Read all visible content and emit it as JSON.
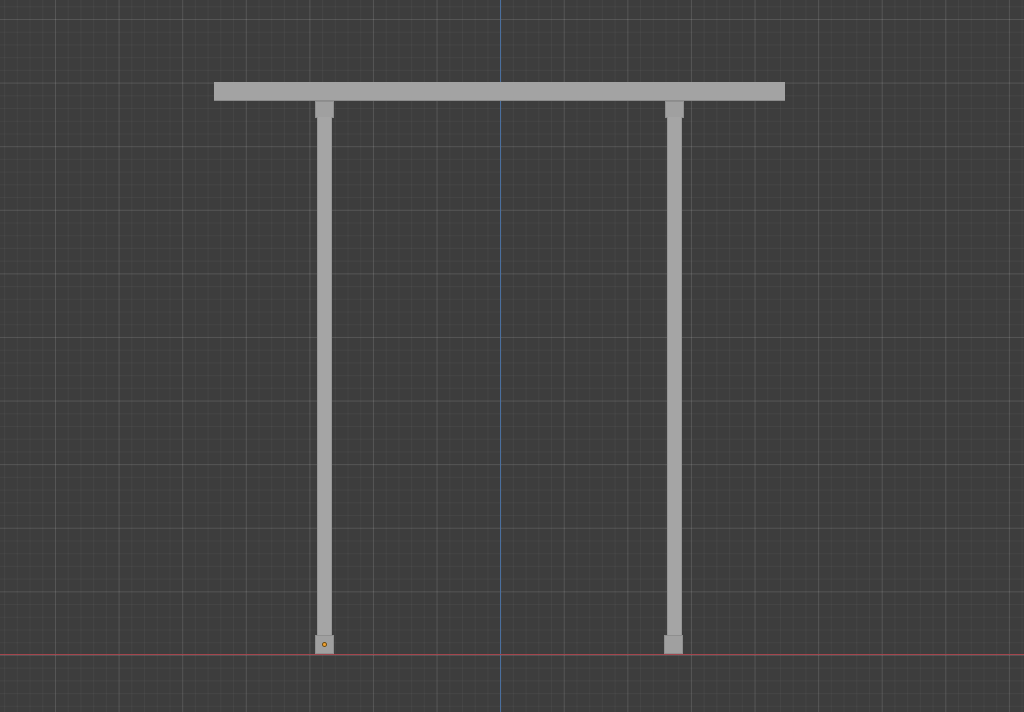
{
  "viewport": {
    "view": "orthographic",
    "colors": {
      "background": "#3d3d3d",
      "grid": "#545454",
      "axis_x": "#a3454d",
      "axis_y": "#4a6f9e",
      "object": "#a3a3a3",
      "origin": "#f0a030"
    }
  },
  "scene": {
    "objects": [
      "top-beam",
      "left-post",
      "right-post",
      "top-left-bracket",
      "top-right-bracket",
      "bottom-left-bracket",
      "bottom-right-bracket"
    ],
    "origin_icon": "origin-point-icon"
  }
}
